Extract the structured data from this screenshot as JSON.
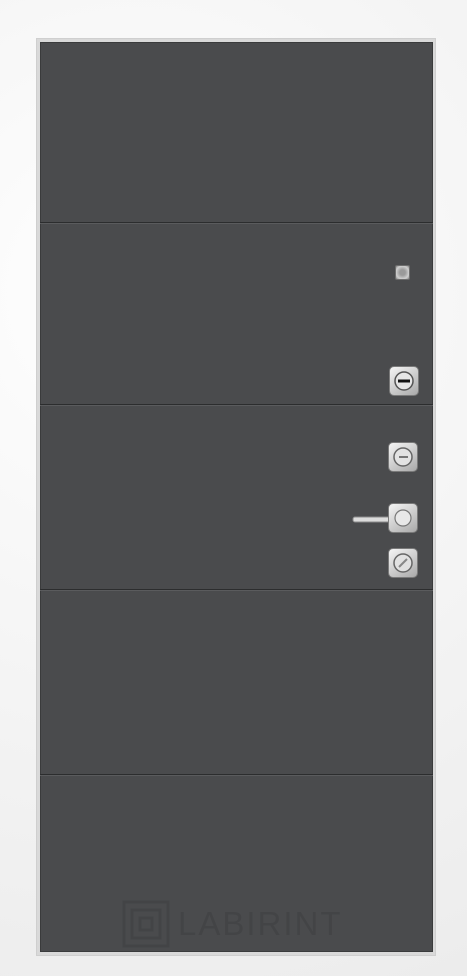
{
  "brand": {
    "logo_text": "LABIRINT"
  },
  "colors": {
    "door_panel": "#4a4b4d",
    "frame": "#f3f3f3",
    "hardware": "#d0d0d0"
  }
}
